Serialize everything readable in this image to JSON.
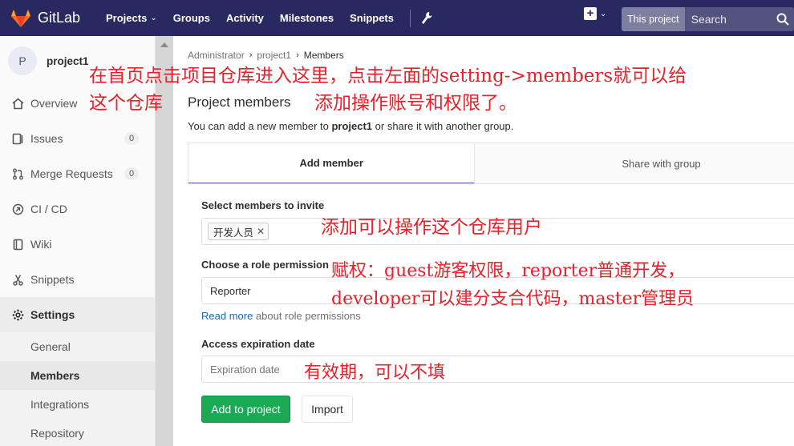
{
  "navbar": {
    "brand": "GitLab",
    "links": [
      {
        "label": "Projects",
        "has_dropdown": true
      },
      {
        "label": "Groups"
      },
      {
        "label": "Activity"
      },
      {
        "label": "Milestones"
      },
      {
        "label": "Snippets"
      }
    ],
    "search_scope": "This project",
    "search_placeholder": "Search",
    "colors": {
      "background": "#292961",
      "logo_orange": "#e24329"
    }
  },
  "sidebar": {
    "project_initial": "P",
    "project_name": "project1",
    "items": [
      {
        "label": "Overview",
        "icon": "home-icon"
      },
      {
        "label": "Issues",
        "icon": "issues-icon",
        "count": "0"
      },
      {
        "label": "Merge Requests",
        "icon": "merge-request-icon",
        "count": "0"
      },
      {
        "label": "CI / CD",
        "icon": "rocket-icon"
      },
      {
        "label": "Wiki",
        "icon": "book-icon"
      },
      {
        "label": "Snippets",
        "icon": "scissors-icon"
      },
      {
        "label": "Settings",
        "icon": "gear-icon"
      }
    ],
    "settings_subitems": [
      {
        "label": "General"
      },
      {
        "label": "Members"
      },
      {
        "label": "Integrations"
      },
      {
        "label": "Repository"
      }
    ]
  },
  "main": {
    "breadcrumb": [
      "Administrator",
      "project1",
      "Members"
    ],
    "title": "Project members",
    "intro_prefix": "You can add a new member to ",
    "intro_project": "project1",
    "intro_suffix": " or share it with another group.",
    "tabs": [
      {
        "label": "Add member"
      },
      {
        "label": "Share with group"
      }
    ],
    "form": {
      "invite_label": "Select members to invite",
      "invite_token": "开发人员",
      "role_label": "Choose a role permission",
      "role_value": "Reporter",
      "role_help_link": "Read more",
      "role_help_text": " about role permissions",
      "expiration_label": "Access expiration date",
      "expiration_placeholder": "Expiration date",
      "add_button": "Add to project",
      "import_button": "Import"
    },
    "accent_color": "#6b4fbb",
    "button_color": "#1aaa55"
  },
  "annotations": {
    "note_1_line_1": "在首页点击项目仓库进入这里，点击左面的setting->members就可以给",
    "note_1_line_2a": "这个仓库",
    "note_1_line_2b": "添加操作账号和权限了。",
    "note_2": "添加可以操作这个仓库用户",
    "note_3_line_1": "赋权：guest游客权限，reporter普通开发，",
    "note_3_line_2": "developer可以建分支合代码，master管理员",
    "note_4": "有效期，可以不填",
    "color": "#e8202a"
  }
}
